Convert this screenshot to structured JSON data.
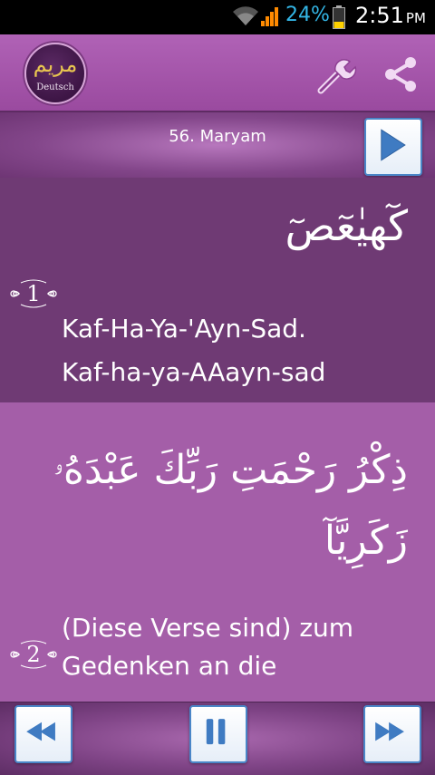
{
  "status_bar": {
    "battery_percent": "24%",
    "time": "2:51",
    "ampm": "PM"
  },
  "app": {
    "logo_arabic": "مريم",
    "logo_language": "Deutsch"
  },
  "surah": {
    "title": "56. Maryam"
  },
  "verses": [
    {
      "number": "1",
      "arabic": "كٓهيٰعٓصٓ",
      "transliteration": "Kaf-Ha-Ya-'Ayn-Sad.",
      "transliteration_alt": "Kaf-ha-ya-AAayn-sad"
    },
    {
      "number": "2",
      "arabic": "ذِكْرُ رَحْمَتِ رَبِّكَ عَبْدَهُۥ زَكَرِيَّآ",
      "translation": "(Diese Verse sind) zum Gedenken an die"
    }
  ],
  "icons": {
    "settings": "wrench-icon",
    "share": "share-icon",
    "play": "play-icon",
    "rewind": "rewind-icon",
    "pause": "pause-icon",
    "fast_forward": "fast-forward-icon"
  },
  "colors": {
    "accent_blue": "#4a86c8",
    "header_purple": "#a857ad",
    "verse_dark": "#6f3a74",
    "verse_light": "#a45ea8",
    "battery_text": "#33b5e5"
  }
}
